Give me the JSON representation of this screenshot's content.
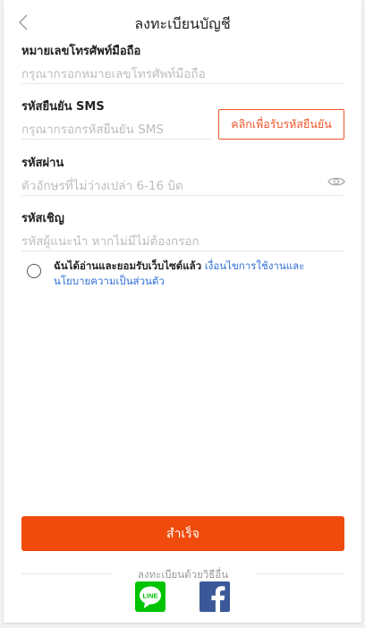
{
  "header": {
    "title": "ลงทะเบียนบัญชี",
    "back_icon": "chevron-left-icon"
  },
  "phone": {
    "label": "หมายเลขโทรศัพท์มือถือ",
    "placeholder": "กรุณากรอกหมายเลขโทรศัพท์มือถือ"
  },
  "sms": {
    "label": "รหัสยืนยัน SMS",
    "placeholder": "กรุณากรอกรหัสยืนยัน SMS",
    "button_label": "คลิกเพื่อรับรหัสยืนยัน"
  },
  "password": {
    "label": "รหัสผ่าน",
    "placeholder": "ตัวอักษรที่ไม่ว่างเปล่า 6-16 บิต",
    "toggle_icon": "eye-icon"
  },
  "invite": {
    "label": "รหัสเชิญ",
    "placeholder": "รหัสผู้แนะนำ หากไม่มีไม่ต้องกรอก"
  },
  "terms": {
    "text": "ฉันได้อ่านและยอมรับเว็บไซต์แล้ว",
    "link": "เงื่อนไขการใช้งานและนโยบายความเป็นส่วนตัว"
  },
  "submit_label": "สำเร็จ",
  "alt_login": {
    "label": "ลงทะเบียนด้วยวิธีอื่น",
    "line_icon_text": "LINE"
  },
  "colors": {
    "accent": "#f04a0c",
    "link": "#2f6fd6",
    "line_green": "#00c300",
    "facebook_blue": "#3b5998"
  }
}
